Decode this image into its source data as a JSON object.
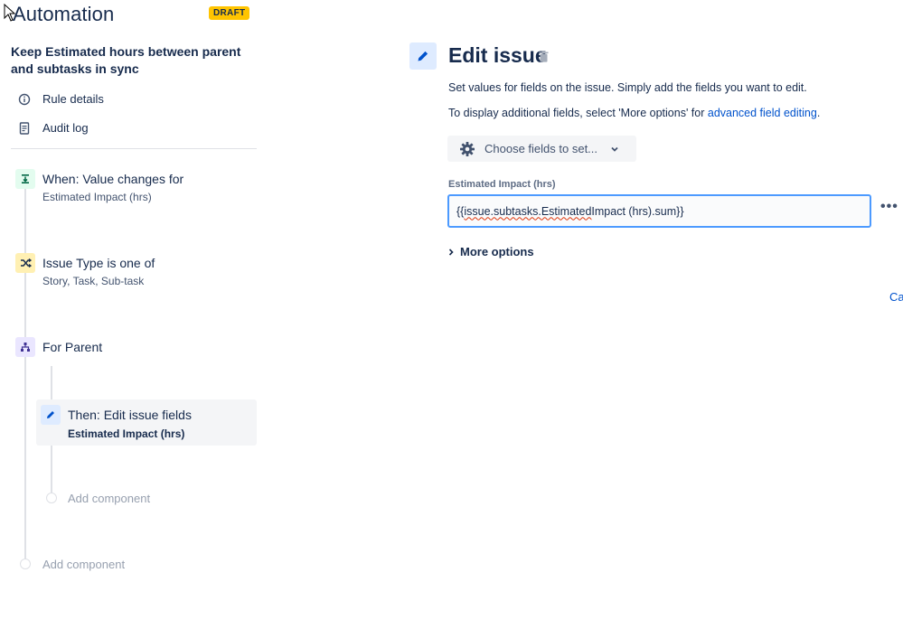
{
  "header": {
    "title": "Automation",
    "draft_badge": "DRAFT"
  },
  "rule": {
    "name": "Keep Estimated hours between parent and subtasks in sync"
  },
  "nav": {
    "rule_details": "Rule details",
    "audit_log": "Audit log"
  },
  "flow": {
    "trigger": {
      "title": "When: Value changes for",
      "subtitle": "Estimated Impact (hrs)"
    },
    "condition": {
      "title": "Issue Type is one of",
      "subtitle": "Story, Task, Sub-task"
    },
    "branch": {
      "title": "For Parent"
    },
    "action": {
      "title": "Then: Edit issue fields",
      "subtitle": "Estimated Impact (hrs)"
    },
    "add_component_inner": "Add component",
    "add_component_outer": "Add component"
  },
  "panel": {
    "title": "Edit issue",
    "description": "Set values for fields on the issue. Simply add the fields you want to edit.",
    "advanced_prefix": "To display additional fields, select 'More options' for ",
    "advanced_link": "advanced field editing",
    "advanced_suffix": ".",
    "choose_fields": "Choose fields to set...",
    "field_label": "Estimated Impact (hrs)",
    "field_value_part1": "{{",
    "field_value_part2": "issue.subtasks.Estimated",
    "field_value_part3": " Impact (hrs).sum}}",
    "more_options": "More options",
    "cancel": "Ca"
  },
  "colors": {
    "trigger_icon_bg": "#e3fcef",
    "condition_icon_bg": "#fff0b3",
    "branch_icon_bg": "#eae6ff",
    "action_icon_bg": "#deebff",
    "link": "#0052cc",
    "draft": "#ffc400"
  },
  "icons": {
    "cursor": "mouse-cursor-icon",
    "rule_details": "info-icon",
    "audit_log": "document-icon",
    "trigger": "trigger-icon",
    "condition": "shuffle-icon",
    "branch": "branch-icon",
    "action": "pencil-icon",
    "trash": "trash-icon",
    "gear": "gear-icon",
    "chevron": "chevron-down-icon"
  }
}
